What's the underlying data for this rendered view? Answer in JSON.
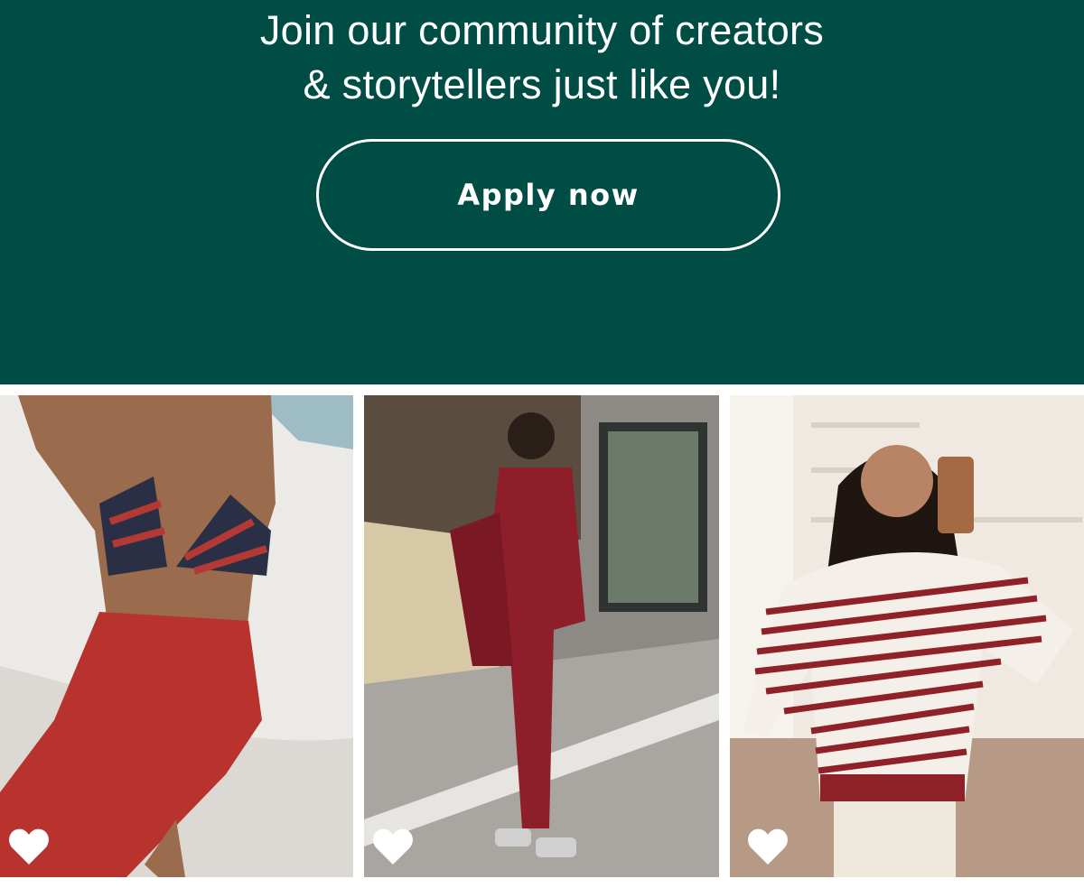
{
  "hero": {
    "line1": "Join our community of creators",
    "line2": "& storytellers just like you!",
    "button_label": "Apply now",
    "bg_color": "#004d45"
  },
  "gallery": {
    "cards": [
      {
        "name": "beach-outfit-photo",
        "favorite_icon": "heart-icon"
      },
      {
        "name": "street-outfit-photo",
        "favorite_icon": "heart-icon"
      },
      {
        "name": "striped-sweater-photo",
        "favorite_icon": "heart-icon"
      }
    ]
  }
}
